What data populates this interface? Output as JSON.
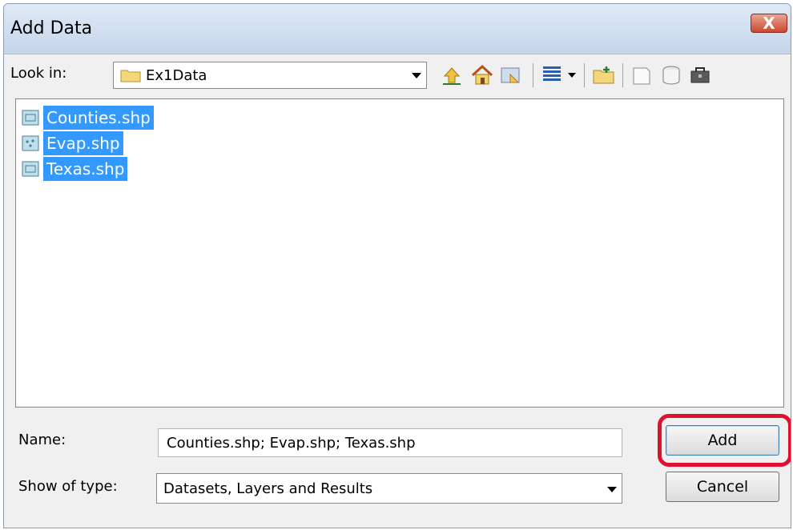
{
  "window": {
    "title": "Add Data",
    "close_glyph": "X"
  },
  "lookin": {
    "label": "Look in:",
    "value": "Ex1Data",
    "icon": "folder-icon"
  },
  "toolbar": {
    "icons": [
      "up-one-level-icon",
      "home-icon",
      "connect-folder-icon",
      "view-menu-icon",
      "new-folder-icon",
      "new-file-icon",
      "new-database-icon",
      "toolbox-icon"
    ]
  },
  "files": [
    {
      "name": "Counties.shp",
      "icon": "polygon-shapefile-icon"
    },
    {
      "name": "Evap.shp",
      "icon": "point-shapefile-icon"
    },
    {
      "name": "Texas.shp",
      "icon": "polygon-shapefile-icon"
    }
  ],
  "name_field": {
    "label": "Name:",
    "value": "Counties.shp; Evap.shp; Texas.shp"
  },
  "type_field": {
    "label": "Show of type:",
    "value": "Datasets, Layers and Results"
  },
  "buttons": {
    "add": "Add",
    "cancel": "Cancel"
  },
  "colors": {
    "selection": "#3399ff",
    "highlight_box": "#e01030"
  }
}
